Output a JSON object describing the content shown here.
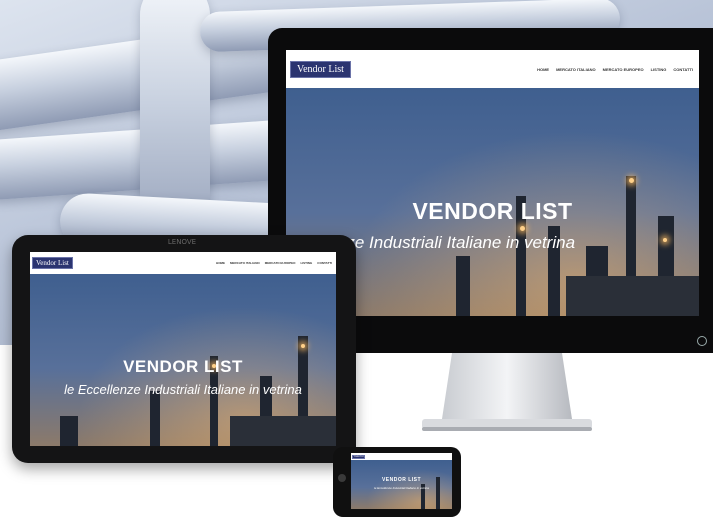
{
  "site": {
    "logo": "Vendor List",
    "nav": [
      "HOME",
      "MERCATO ITALIANO",
      "MERCATO EUROPEO",
      "LISTING",
      "CONTATTI"
    ],
    "hero_title": "VENDOR LIST",
    "hero_subtitle_monitor": "cellenze Industriali Italiane in vetrina",
    "hero_subtitle_tablet": "le Eccellenze Industriali Italiane in vetrina"
  },
  "tablet": {
    "brand_text": "LENOVE"
  },
  "colors": {
    "logo_bg": "#2b3470",
    "device_body": "#0b0b0c",
    "hero_sky": "#4a6491"
  }
}
